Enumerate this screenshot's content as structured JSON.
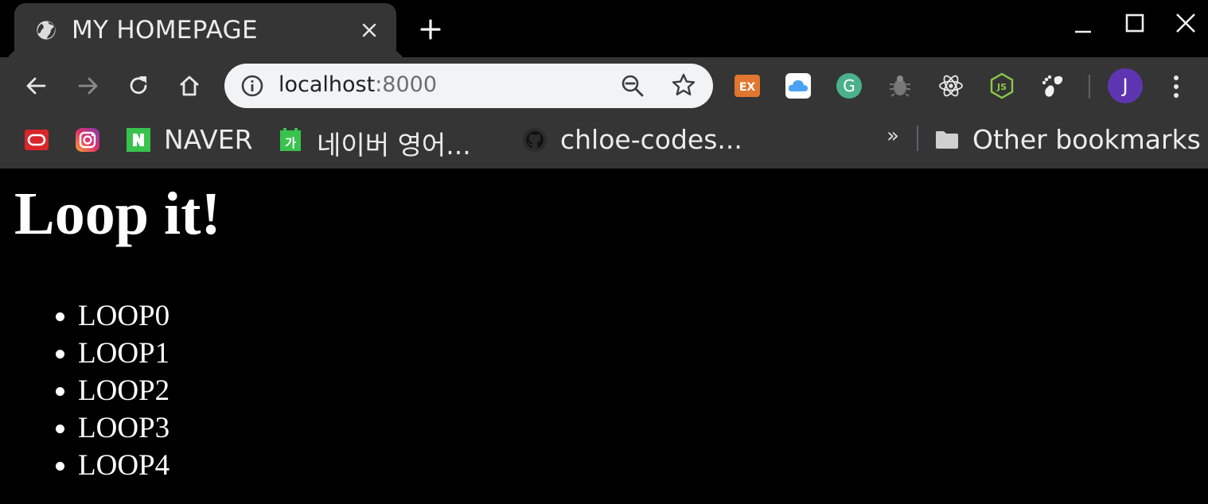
{
  "browser": {
    "tab": {
      "title": "MY HOMEPAGE",
      "favicon": "globe-icon"
    },
    "window_controls": [
      "minimize-icon",
      "maximize-icon",
      "close-icon"
    ],
    "address_bar": {
      "host": "localhost",
      "port": ":8000"
    },
    "extensions": [
      "ex-extension-icon",
      "cloud-extension-icon",
      "grammarly-extension-icon",
      "bug-extension-icon",
      "react-devtools-icon",
      "nodejs-icon",
      "gnome-extension-icon"
    ],
    "profile_initial": "J",
    "bookmarks": {
      "items": [
        {
          "label": "",
          "icon": "oracle-icon"
        },
        {
          "label": "",
          "icon": "instagram-icon"
        },
        {
          "label": "NAVER",
          "icon": "naver-icon"
        },
        {
          "label": "네이버 영어...",
          "icon": "naver-dictionary-icon"
        },
        {
          "label": "chloe-codes...",
          "icon": "github-icon"
        }
      ],
      "overflow": "»",
      "other_label": "Other bookmarks"
    }
  },
  "colors": {
    "chrome_dark": "#353535",
    "page_background": "#000000",
    "page_text": "#ffffff",
    "profile": "#5e35b1"
  },
  "page": {
    "heading": "Loop it!",
    "list": [
      "LOOP0",
      "LOOP1",
      "LOOP2",
      "LOOP3",
      "LOOP4"
    ]
  }
}
